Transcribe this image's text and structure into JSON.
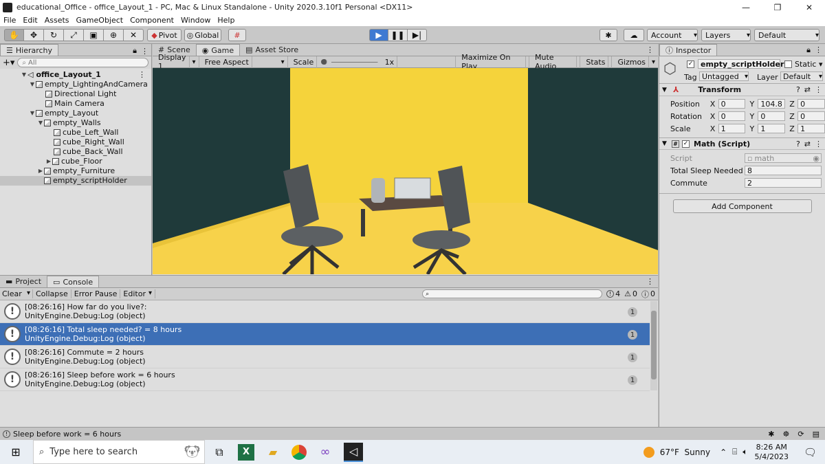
{
  "window": {
    "title": "educational_Office - office_Layout_1 - PC, Mac & Linux Standalone - Unity 2020.3.10f1 Personal <DX11>",
    "min": "—",
    "max": "❐",
    "close": "✕"
  },
  "menu": [
    "File",
    "Edit",
    "Assets",
    "GameObject",
    "Component",
    "Window",
    "Help"
  ],
  "toolbar": {
    "pivot": "Pivot",
    "global": "Global",
    "account": "Account",
    "layers": "Layers",
    "layout": "Default"
  },
  "hierarchy": {
    "tab": "Hierarchy",
    "search_placeholder": "All",
    "scene": "office_Layout_1",
    "items": [
      {
        "label": "empty_LightingAndCamera"
      },
      {
        "label": "Directional Light"
      },
      {
        "label": "Main Camera"
      },
      {
        "label": "empty_Layout"
      },
      {
        "label": "empty_Walls"
      },
      {
        "label": "cube_Left_Wall"
      },
      {
        "label": "cube_Right_Wall"
      },
      {
        "label": "cube_Back_Wall"
      },
      {
        "label": "cube_Floor"
      },
      {
        "label": "empty_Furniture"
      },
      {
        "label": "empty_scriptHolder"
      }
    ]
  },
  "center_tabs": [
    "Scene",
    "Game",
    "Asset Store"
  ],
  "game_toolbar": {
    "display": "Display 1",
    "aspect": "Free Aspect",
    "scale_label": "Scale",
    "scale_value": "1x",
    "maximize": "Maximize On Play",
    "mute": "Mute Audio",
    "stats": "Stats",
    "gizmos": "Gizmos"
  },
  "inspector": {
    "tab": "Inspector",
    "object_name": "empty_scriptHolder",
    "static_label": "Static",
    "tag_label": "Tag",
    "tag_value": "Untagged",
    "layer_label": "Layer",
    "layer_value": "Default",
    "transform": {
      "title": "Transform",
      "position": {
        "label": "Position",
        "x": "0",
        "y": "104.8",
        "z": "0"
      },
      "rotation": {
        "label": "Rotation",
        "x": "0",
        "y": "0",
        "z": "0"
      },
      "scale": {
        "label": "Scale",
        "x": "1",
        "y": "1",
        "z": "1"
      }
    },
    "script": {
      "title": "Math (Script)",
      "script_label": "Script",
      "script_value": "math",
      "sleep_label": "Total Sleep Needed",
      "sleep_value": "8",
      "commute_label": "Commute",
      "commute_value": "2"
    },
    "add_component": "Add Component"
  },
  "console": {
    "tabs": [
      "Project",
      "Console"
    ],
    "clear": "Clear",
    "collapse": "Collapse",
    "error_pause": "Error Pause",
    "editor": "Editor",
    "counts": {
      "log": "4",
      "warn": "0",
      "error": "0"
    },
    "entries": [
      {
        "line1": "[08:26:16] How far do you live?:",
        "line2": "UnityEngine.Debug:Log (object)",
        "count": "1"
      },
      {
        "line1": "[08:26:16] Total sleep needed? = 8 hours",
        "line2": "UnityEngine.Debug:Log (object)",
        "count": "1"
      },
      {
        "line1": "[08:26:16] Commute = 2 hours",
        "line2": "UnityEngine.Debug:Log (object)",
        "count": "1"
      },
      {
        "line1": "[08:26:16] Sleep before work = 6 hours",
        "line2": "UnityEngine.Debug:Log (object)",
        "count": "1"
      }
    ]
  },
  "status": "Sleep before work = 6 hours",
  "taskbar": {
    "search_placeholder": "Type here to search",
    "weather": "67°F  Sunny",
    "time": "8:26 AM",
    "date": "5/4/2023"
  },
  "colors": {
    "selection": "#3d6fb6",
    "play_active": "#3f7ad2",
    "wall": "#f7d53a",
    "background": "#1f3a3a"
  }
}
